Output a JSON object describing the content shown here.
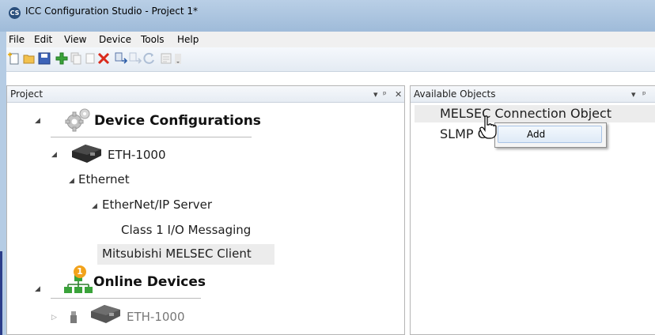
{
  "window": {
    "title": "ICC Configuration Studio - Project 1*",
    "app_icon_text": "CS"
  },
  "menu": [
    "File",
    "Edit",
    "View",
    "Device",
    "Tools",
    "Help"
  ],
  "toolbar": {
    "icons": [
      "new-file-icon",
      "open-folder-icon",
      "save-icon",
      "add-icon",
      "copy-icon",
      "blank-icon",
      "delete-icon",
      "download-icon",
      "upload-icon",
      "refresh-icon",
      "properties-icon",
      "overflow-icon"
    ]
  },
  "project_pane": {
    "title": "Project",
    "controls": [
      "▾",
      "ᵖ",
      "✕"
    ],
    "tree": {
      "device_configurations": "Device Configurations",
      "eth_device": "ETH-1000",
      "ethernet": "Ethernet",
      "ethernet_ip_server": "EtherNet/IP Server",
      "class1_io": "Class 1 I/O Messaging",
      "melsec_client": "Mitsubishi MELSEC Client",
      "online_devices": "Online Devices",
      "online_badge": "1",
      "online_eth_device": "ETH-1000"
    }
  },
  "objects_pane": {
    "title": "Available Objects",
    "controls": [
      "▾",
      "ᵖ"
    ],
    "items": [
      "MELSEC Connection Object",
      "SLMP C"
    ]
  },
  "context_menu": {
    "items": [
      "Add"
    ]
  },
  "colors": {
    "title_bar": "#b9cfe6",
    "selection": "#ececec",
    "menu_highlight": "#dfeaf7",
    "add_green": "#3aa33a",
    "delete_red": "#d92a1c"
  }
}
